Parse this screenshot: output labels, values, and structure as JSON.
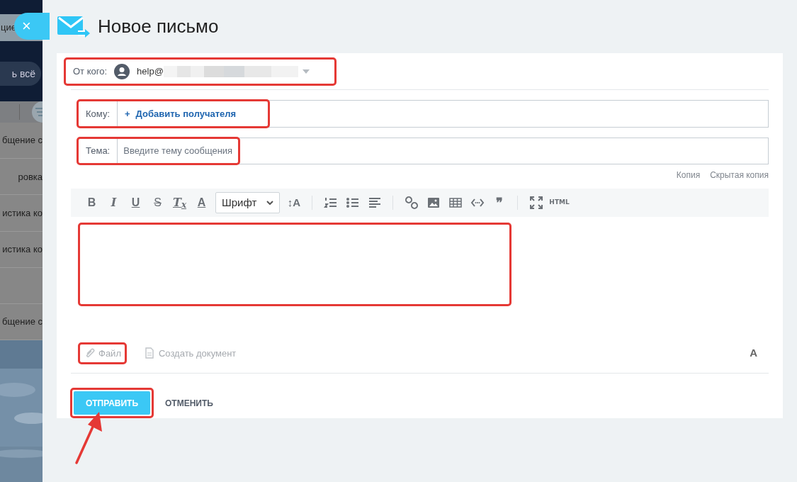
{
  "background_app": {
    "tag": "цие",
    "button": "ь всё",
    "rows": [
      {
        "kind": "text",
        "text": "бщение с"
      },
      {
        "kind": "text",
        "text": "ровка"
      },
      {
        "kind": "text",
        "text": "истика ко"
      },
      {
        "kind": "text",
        "text": "истика ко"
      },
      {
        "kind": "blank"
      },
      {
        "kind": "text",
        "text": "бщение с"
      }
    ]
  },
  "close_button": {
    "label": "×"
  },
  "title": "Новое письмо",
  "from": {
    "label": "От кого:",
    "value": "help@",
    "highlighted": true
  },
  "to": {
    "label": "Кому:",
    "add_icon": "+",
    "add_label": "Добавить получателя",
    "highlighted": true
  },
  "subject": {
    "label": "Тема:",
    "placeholder": "Введите тему сообщения",
    "highlighted": true
  },
  "copy_links": [
    "Копия",
    "Скрытая копия"
  ],
  "toolbar": [
    {
      "kind": "glyph",
      "text": "B"
    },
    {
      "kind": "glyph",
      "text": "I"
    },
    {
      "kind": "glyph",
      "text": "U"
    },
    {
      "kind": "glyph",
      "text": "S"
    },
    {
      "kind": "glyph",
      "text": "T$_{x}$"
    },
    {
      "kind": "glyph",
      "text": "A"
    },
    {
      "kind": "dropdown",
      "text": "Шрифт"
    },
    {
      "kind": "glyph",
      "text": "↕A"
    },
    {
      "kind": "separator"
    },
    {
      "kind": "icon"
    },
    {
      "kind": "icon"
    },
    {
      "kind": "icon"
    },
    {
      "kind": "separator"
    },
    {
      "kind": "icon"
    },
    {
      "kind": "icon"
    },
    {
      "kind": "icon"
    },
    {
      "kind": "icon"
    },
    {
      "kind": "glyph",
      "text": "❞"
    },
    {
      "kind": "separator"
    },
    {
      "kind": "icon"
    },
    {
      "kind": "glyph",
      "text": "HTML"
    }
  ],
  "editor": {
    "highlighted": true
  },
  "attachments": [
    {
      "label": "Файл",
      "highlighted": true
    },
    {
      "label": "Создать документ",
      "highlighted": false
    }
  ],
  "format_toggle": "A",
  "buttons": [
    {
      "kind": "primary",
      "label": "ОТПРАВИТЬ",
      "highlighted": true
    },
    {
      "kind": "link",
      "label": "ОТМЕНИТЬ",
      "highlighted": false
    }
  ],
  "pointer_arrow": true
}
